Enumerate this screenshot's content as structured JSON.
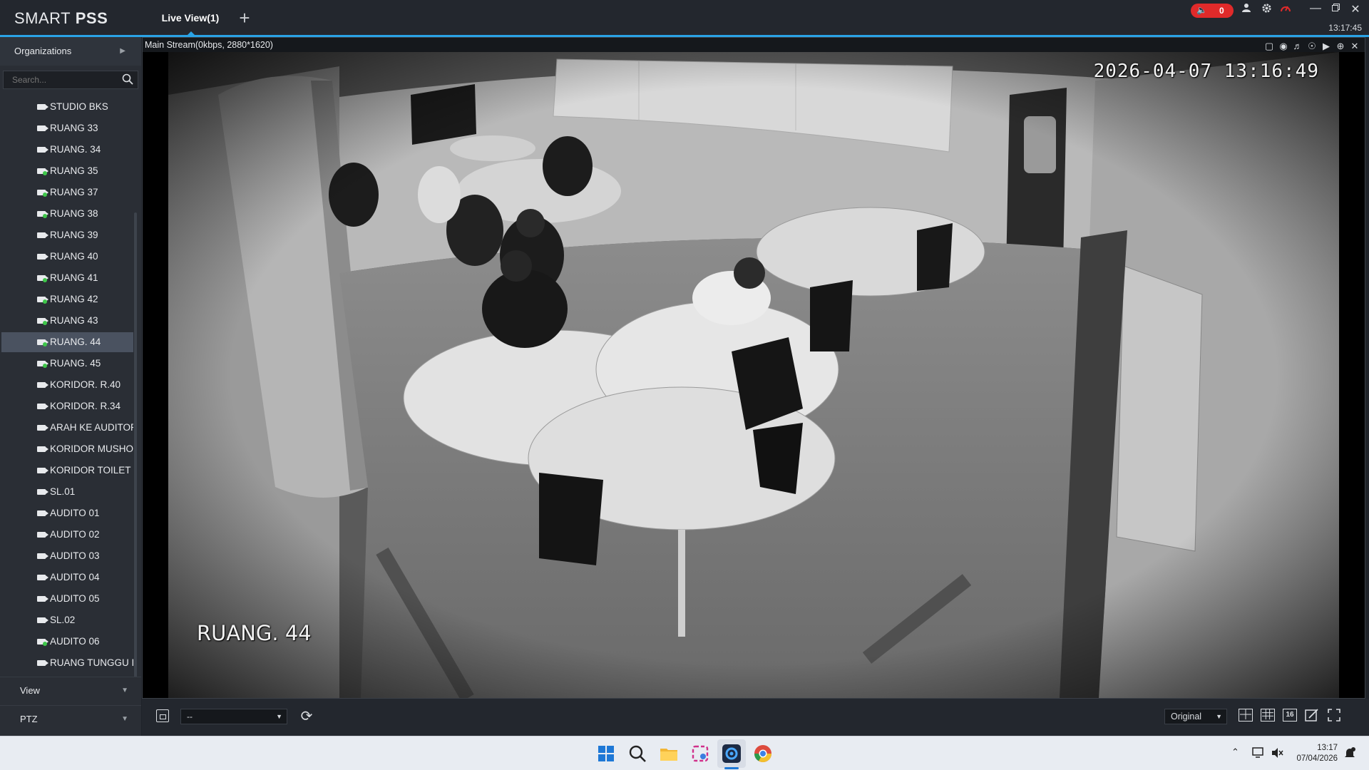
{
  "app": {
    "logo_light": "SMART",
    "logo_bold": " PSS",
    "tab_label": "Live View(1)",
    "add_tab": "+",
    "alarm_count": "0",
    "clock": "13:17:45"
  },
  "sidebar": {
    "organizations_label": "Organizations",
    "search_placeholder": "Search...",
    "cameras": [
      {
        "label": "STUDIO BKS",
        "online": false
      },
      {
        "label": "RUANG 33",
        "online": false
      },
      {
        "label": "RUANG. 34",
        "online": false
      },
      {
        "label": "RUANG 35",
        "online": true
      },
      {
        "label": "RUANG  37",
        "online": true
      },
      {
        "label": "RUANG 38",
        "online": true
      },
      {
        "label": "RUANG 39",
        "online": false
      },
      {
        "label": "RUANG 40",
        "online": false
      },
      {
        "label": "RUANG 41",
        "online": true
      },
      {
        "label": "RUANG 42",
        "online": true
      },
      {
        "label": "RUANG 43",
        "online": true
      },
      {
        "label": "RUANG. 44",
        "online": true,
        "selected": true
      },
      {
        "label": "RUANG. 45",
        "online": true
      },
      {
        "label": "KORIDOR. R.40",
        "online": false
      },
      {
        "label": "KORIDOR. R.34",
        "online": false
      },
      {
        "label": "ARAH KE AUDITOR",
        "online": false
      },
      {
        "label": "KORIDOR MUSHO",
        "online": false
      },
      {
        "label": "KORIDOR TOILET",
        "online": false
      },
      {
        "label": "SL.01",
        "online": false
      },
      {
        "label": "AUDITO 01",
        "online": false
      },
      {
        "label": "AUDITO 02",
        "online": false
      },
      {
        "label": "AUDITO 03",
        "online": false
      },
      {
        "label": "AUDITO 04",
        "online": false
      },
      {
        "label": "AUDITO 05",
        "online": false
      },
      {
        "label": "SL.02",
        "online": false
      },
      {
        "label": "AUDITO 06",
        "online": true
      },
      {
        "label": "RUANG TUNGGU I",
        "online": false
      }
    ],
    "view_label": "View",
    "ptz_label": "PTZ"
  },
  "video": {
    "stream_info": "Main Stream(0kbps, 2880*1620)",
    "osd_timestamp": "2026-04-07 13:16:49",
    "osd_camera_name": "RUANG. 44"
  },
  "controls": {
    "preset_value": "--",
    "zoom_value": "Original",
    "layout_16_label": "16"
  },
  "taskbar": {
    "time": "13:17",
    "date": "07/04/2026"
  },
  "colors": {
    "accent": "#2aa3e6",
    "alarm": "#e02a2a",
    "online": "#3ec74a",
    "selected_row": "#4a5260"
  }
}
